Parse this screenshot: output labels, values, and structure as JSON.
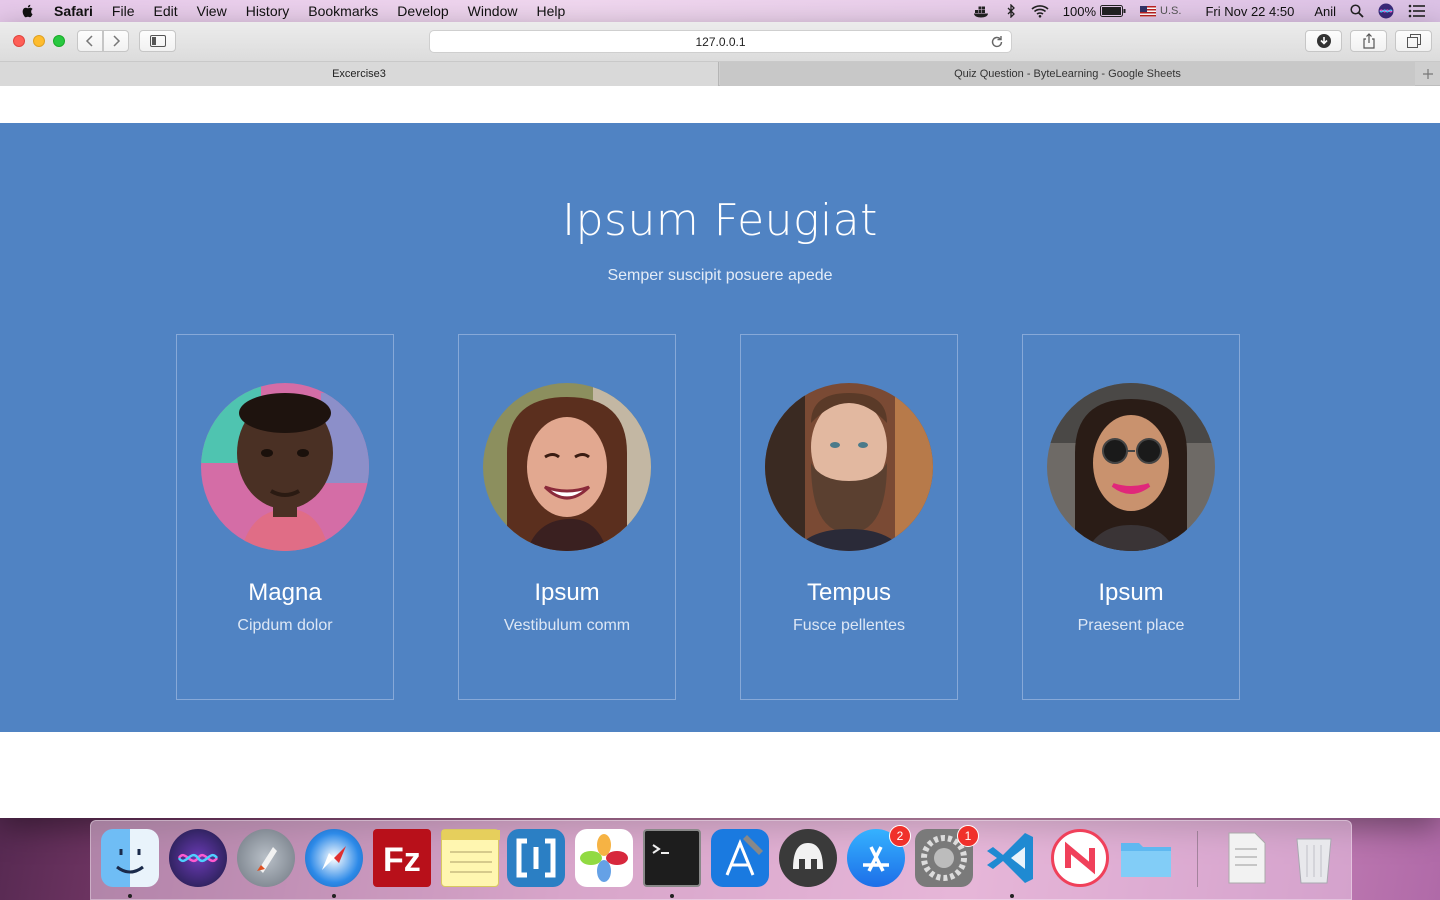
{
  "menubar": {
    "app": "Safari",
    "items": [
      "File",
      "Edit",
      "View",
      "History",
      "Bookmarks",
      "Develop",
      "Window",
      "Help"
    ],
    "battery": "100%",
    "input_source": "U.S.",
    "datetime": "Fri Nov 22  4:50",
    "user": "Anil"
  },
  "browser": {
    "url": "127.0.0.1",
    "tabs": [
      {
        "label": "Excercise3",
        "active": true
      },
      {
        "label": "Quiz Question - ByteLearning - Google Sheets",
        "active": false
      }
    ]
  },
  "team": {
    "title": "Ipsum Feugiat",
    "subtitle": "Semper suscipit posuere apede",
    "members": [
      {
        "name": "Magna",
        "role": "Cipdum dolor"
      },
      {
        "name": "Ipsum",
        "role": "Vestibulum comm"
      },
      {
        "name": "Tempus",
        "role": "Fusce pellentes"
      },
      {
        "name": "Ipsum",
        "role": "Praesent place"
      }
    ]
  },
  "dock": {
    "apps": [
      {
        "name": "finder",
        "running": true
      },
      {
        "name": "siri",
        "running": false
      },
      {
        "name": "launchpad",
        "running": false
      },
      {
        "name": "safari",
        "running": true
      },
      {
        "name": "filezilla",
        "running": false
      },
      {
        "name": "notes",
        "running": false
      },
      {
        "name": "brackets",
        "running": false
      },
      {
        "name": "photos",
        "running": false
      },
      {
        "name": "terminal",
        "running": true
      },
      {
        "name": "xcode",
        "running": false
      },
      {
        "name": "sequel-pro",
        "running": false
      },
      {
        "name": "app-store",
        "running": false,
        "badge": "2"
      },
      {
        "name": "system-preferences",
        "running": false,
        "badge": "1"
      },
      {
        "name": "vscode",
        "running": true
      },
      {
        "name": "news",
        "running": false
      },
      {
        "name": "folder",
        "running": false
      },
      {
        "name": "xlsx-file",
        "running": false
      },
      {
        "name": "trash",
        "running": false
      }
    ]
  },
  "colors": {
    "section_bg": "#5083c3",
    "card_border": "#87a9d8"
  }
}
